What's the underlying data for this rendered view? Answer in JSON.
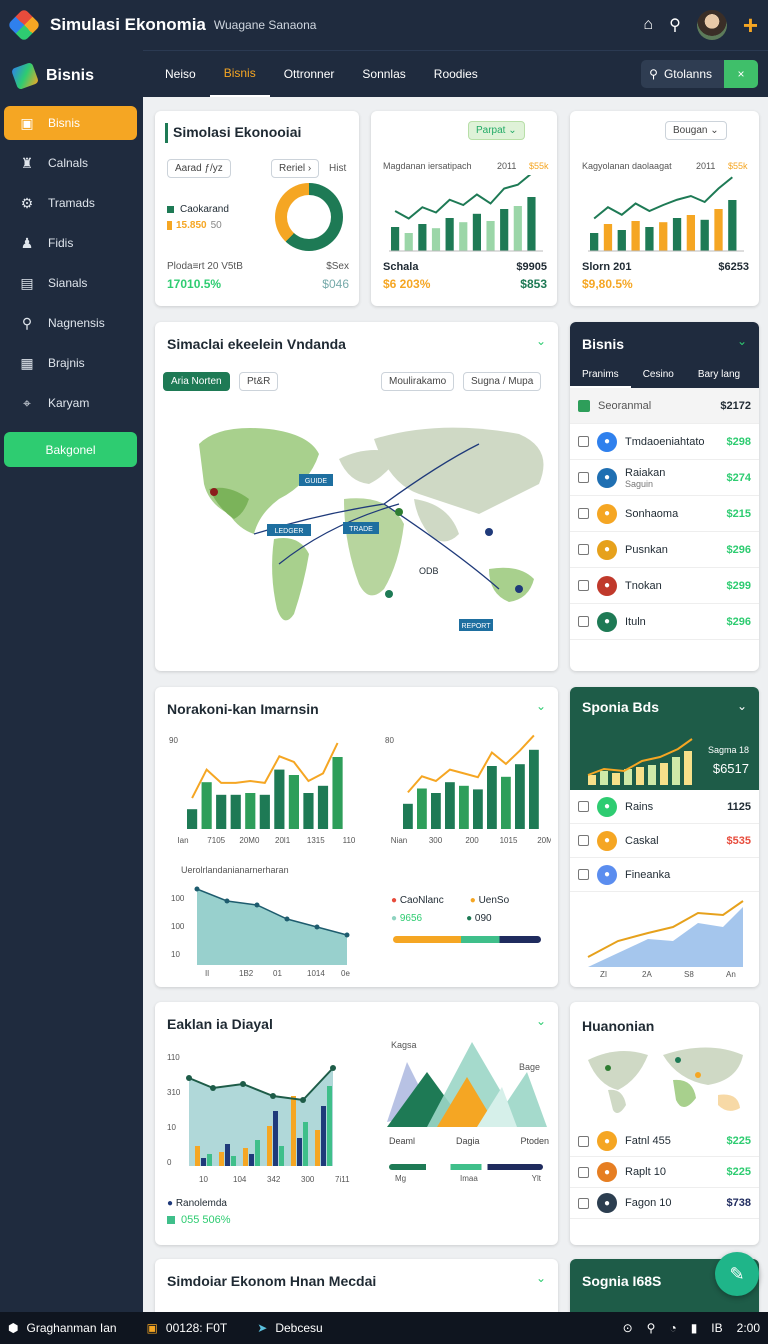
{
  "app": {
    "title": "Simulasi Ekonomia",
    "subtitle": "Wuagane Sanaona"
  },
  "sidebar": {
    "brand": "Bisnis",
    "items": [
      {
        "label": "Bisnis",
        "icon": "briefcase-icon",
        "glyph": "▣"
      },
      {
        "label": "Calnals",
        "icon": "chart-icon",
        "glyph": "♜"
      },
      {
        "label": "Tramads",
        "icon": "gear-icon",
        "glyph": "⚙"
      },
      {
        "label": "Fidis",
        "icon": "person-icon",
        "glyph": "♟"
      },
      {
        "label": "Sianals",
        "icon": "document-icon",
        "glyph": "▤"
      },
      {
        "label": "Nagnensis",
        "icon": "search-icon",
        "glyph": "⚲"
      },
      {
        "label": "Brajnis",
        "icon": "grid-icon",
        "glyph": "▦"
      },
      {
        "label": "Karyam",
        "icon": "location-icon",
        "glyph": "⌖"
      }
    ],
    "button": "Bakgonel"
  },
  "tabs": [
    "Neiso",
    "Bisnis",
    "Ottronner",
    "Sonnlas",
    "Roodies"
  ],
  "search": {
    "label": "Gtolanns",
    "go": "×"
  },
  "card1": {
    "title": "Simolasi Ekonooiai",
    "pill1": "Aarad ƒ/yz",
    "pill2": "Reriel ›",
    "hint": "Hist",
    "legend1": "Caokarand",
    "legend2": "15.850",
    "legend2b": "50",
    "foot_l": "Ploda≡rt 20 V5tB",
    "foot_r": "$Sex",
    "val_l": "17010.5%",
    "val_r": "$046"
  },
  "card2": {
    "pill": "Parpat",
    "label": "Magdanan iersatipach",
    "years": "2011",
    "price": "$55k",
    "foot_l": "Schala",
    "foot_r": "$9905",
    "val_l": "$6 203%",
    "val_r": "$853"
  },
  "card3": {
    "pill": "Bougan",
    "label": "Kagyolanan daolaagat",
    "years": "2011",
    "price": "$55k",
    "foot_l": "Slorn 201",
    "foot_r": "$6253",
    "val_l": "$9,80.5%",
    "val_r": ""
  },
  "map_card": {
    "title": "Simaclai ekeelein Vndanda",
    "pill1": "Aria Norten",
    "pill2": "Pt&R",
    "pill3": "Moulirakamo",
    "pill4": "Sugna / Mupa",
    "tags": [
      "GUIDE",
      "LEDGER",
      "REPORT",
      "TRADE"
    ],
    "badge": "ODB"
  },
  "bisnis_card": {
    "title": "Bisnis",
    "tabs": [
      "Pranims",
      "Cesino",
      "Bary lang"
    ],
    "head_label": "Seoranmal",
    "head_amt": "$2172",
    "rows": [
      {
        "label": "Tmdaoeniahtato",
        "amt": "$298",
        "color": "#2f80ed"
      },
      {
        "label": "Raiakan",
        "sub": "Saguin",
        "amt": "$274",
        "color": "#1f6fb2"
      },
      {
        "label": "Sonhaoma",
        "amt": "$215",
        "color": "#f5a623"
      },
      {
        "label": "Pusnkan",
        "amt": "$296",
        "color": "#e6a11c"
      },
      {
        "label": "Tnokan",
        "amt": "$299",
        "color": "#c0392b"
      },
      {
        "label": "Ituln",
        "amt": "$296",
        "color": "#1e7a55"
      }
    ]
  },
  "analysis_card": {
    "title": "Norakoni-kan Imarnsin",
    "y1": "90",
    "x1": [
      "Ian",
      "7105",
      "20M0",
      "20l1",
      "1315",
      "110"
    ],
    "y2": "80",
    "x2": [
      "Nian",
      "300",
      "200",
      "1015",
      "20M"
    ],
    "area_title": "Uerolrlandanianarnerharan",
    "area_y": [
      "100",
      "100",
      "10"
    ],
    "area_x": [
      "Il",
      "1B2",
      "01",
      "1014",
      "0e"
    ],
    "legend": [
      "CaoNlanc",
      "UenSo"
    ],
    "legend_vals": [
      "9656",
      "090"
    ],
    "chart_data": {
      "type": "bar",
      "series": [
        {
          "name": "",
          "values": [
            22,
            52,
            38,
            38,
            40,
            38,
            66,
            60,
            40,
            48,
            80
          ]
        },
        {
          "name": "",
          "values": [
            28,
            45,
            40,
            52,
            48,
            44,
            70,
            58,
            72,
            88
          ]
        }
      ]
    }
  },
  "spogia_card": {
    "title": "Sponia Bds",
    "stat_label": "Sagma 18",
    "stat_value": "$6517",
    "rows": [
      {
        "label": "Rains",
        "amt": "1125",
        "color": "#2ecc71"
      },
      {
        "label": "Caskal",
        "amt": "$535",
        "color": "#f5a623"
      },
      {
        "label": "Fineanka",
        "amt": "",
        "color": "#5b8def"
      }
    ],
    "x": [
      "ZI",
      "2A",
      "S8",
      "An"
    ]
  },
  "eaklan_card": {
    "title": "Eaklan ia Diayal",
    "y": [
      "110",
      "310",
      "10",
      "0"
    ],
    "x": [
      "10",
      "104",
      "342",
      "300",
      "7i11"
    ],
    "legend": "Ranolemda",
    "legend_val": "055 506%",
    "mountain_label": "Kagsa",
    "mountain_tag": "Bage",
    "m_labels": [
      "Deaml",
      "Dagia",
      "Ptoden"
    ],
    "m_axis": [
      "Mg",
      "Imaa",
      "Ylt"
    ]
  },
  "huan_card": {
    "title": "Huanonian",
    "rows": [
      {
        "label": "Fatnl 455",
        "amt": "$225",
        "color": "#f5a623"
      },
      {
        "label": "Raplt 10",
        "amt": "$225",
        "color": "#e67e22"
      },
      {
        "label": "Fagon 10",
        "amt": "$738",
        "color": "#2c3e50"
      }
    ]
  },
  "bottom_card": {
    "title": "Simdoiar Ekonom Hnan Mecdai"
  },
  "bottom_right": {
    "title": "Sognia I68S"
  },
  "statusbar": {
    "item1": "Graghanman Ian",
    "item2": "00128: F0T",
    "item3": "Debcesu",
    "right": "IB",
    "right2": "2:00"
  }
}
